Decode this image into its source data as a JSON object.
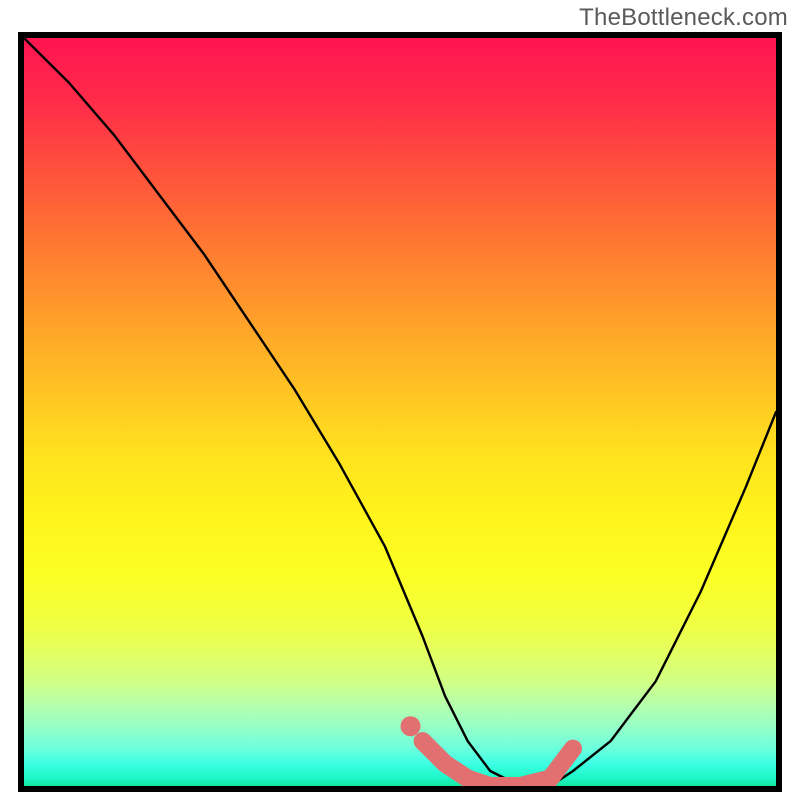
{
  "attribution": "TheBottleneck.com",
  "chart_data": {
    "type": "line",
    "title": "",
    "xlabel": "",
    "ylabel": "",
    "xlim": [
      0,
      100
    ],
    "ylim": [
      0,
      100
    ],
    "series": [
      {
        "name": "bottleneck-curve",
        "x": [
          0,
          6,
          12,
          18,
          24,
          30,
          36,
          42,
          48,
          53,
          56,
          59,
          62,
          66,
          70,
          73,
          78,
          84,
          90,
          96,
          100
        ],
        "y": [
          100,
          94,
          87,
          79,
          71,
          62,
          53,
          43,
          32,
          20,
          12,
          6,
          2,
          0,
          0,
          2,
          6,
          14,
          26,
          40,
          50
        ]
      },
      {
        "name": "optimal-range-highlight",
        "x": [
          53,
          56,
          59,
          62,
          66,
          70,
          73
        ],
        "y": [
          6,
          3,
          1,
          0,
          0,
          1,
          5
        ]
      }
    ],
    "annotations": []
  }
}
